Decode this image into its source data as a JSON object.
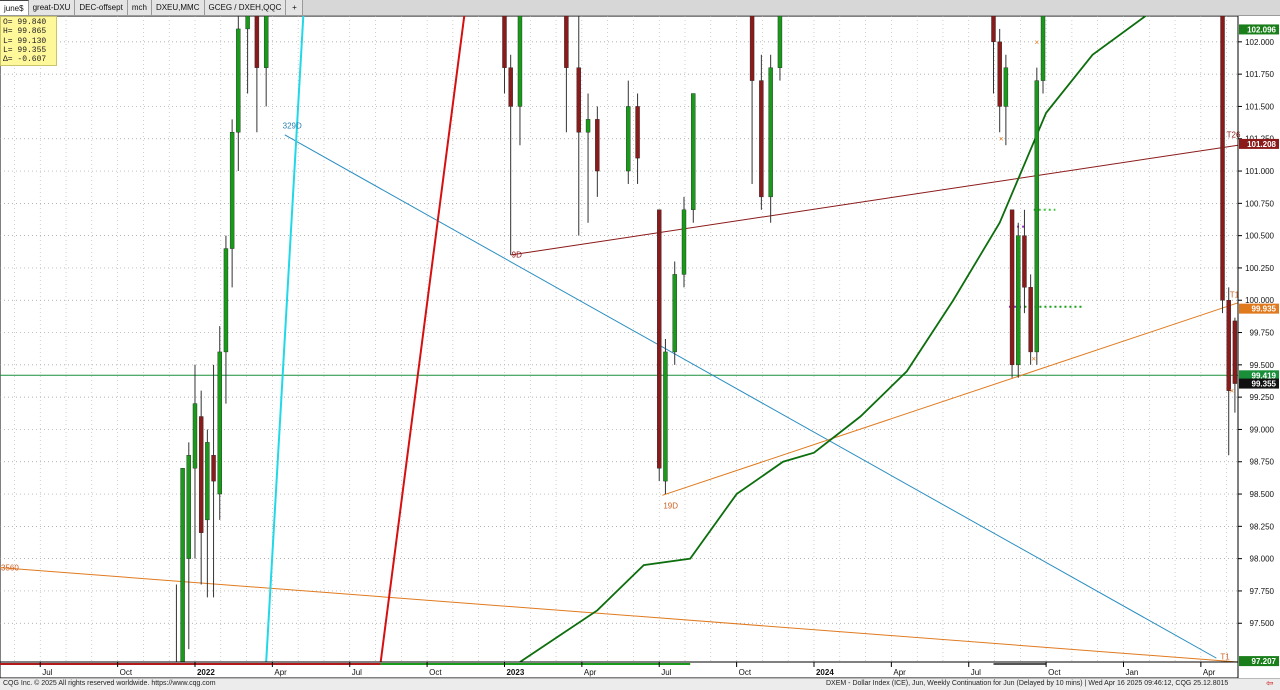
{
  "tabs": [
    {
      "label": "june$",
      "active": true
    },
    {
      "label": "great-DXU",
      "active": false
    },
    {
      "label": "DEC-offsept",
      "active": false
    },
    {
      "label": "mch",
      "active": false
    },
    {
      "label": "DXEU,MMC",
      "active": false
    },
    {
      "label": "GCEG / DXEH,QQC",
      "active": false
    },
    {
      "label": "+",
      "active": false
    }
  ],
  "ohlc": {
    "open": "O= 99.840",
    "high": "H= 99.865",
    "low": "L= 99.130",
    "last": "L= 99.355",
    "delta": "Δ= -0.607"
  },
  "footer": {
    "left": "CQG Inc. © 2025 All rights reserved worldwide. https://www.cqg.com",
    "right": "DXEM - Dollar Index (ICE), Jun, Weekly Continuation for Jun (Delayed by 10 mins) | Wed Apr 16 2025 09:46:12, CQG 25.12.8015",
    "arrow": "⇦"
  },
  "chart_data": {
    "type": "candlestick",
    "grid": true,
    "y_axis": {
      "side": "right",
      "min": 97.2,
      "max": 102.2,
      "ticks": [
        "97.500",
        "97.750",
        "98.000",
        "98.250",
        "98.500",
        "98.750",
        "99.000",
        "99.250",
        "99.500",
        "99.750",
        "100.000",
        "100.250",
        "100.500",
        "100.750",
        "101.000",
        "101.250",
        "101.500",
        "101.750",
        "102.000"
      ]
    },
    "x_axis": {
      "labels": [
        {
          "text": "Jul",
          "x": 2021.5
        },
        {
          "text": "Oct",
          "x": 2021.75
        },
        {
          "text": "2022",
          "x": 2022.0
        },
        {
          "text": "Apr",
          "x": 2022.25
        },
        {
          "text": "Jul",
          "x": 2022.5
        },
        {
          "text": "Oct",
          "x": 2022.75
        },
        {
          "text": "2023",
          "x": 2023.0
        },
        {
          "text": "Apr",
          "x": 2023.25
        },
        {
          "text": "Jul",
          "x": 2023.5
        },
        {
          "text": "Oct",
          "x": 2023.75
        },
        {
          "text": "2024",
          "x": 2024.0
        },
        {
          "text": "Apr",
          "x": 2024.25
        },
        {
          "text": "Jul",
          "x": 2024.5
        },
        {
          "text": "Oct",
          "x": 2024.75
        },
        {
          "text": "Jan",
          "x": 2025.0
        },
        {
          "text": "Apr",
          "x": 2025.25
        }
      ],
      "min": 2021.37,
      "max": 2025.37
    },
    "price_labels": [
      {
        "text": "102.096",
        "value": 102.096,
        "bg": "#1a7f1a",
        "fg": "#ffffff"
      },
      {
        "text": "101.208",
        "value": 101.21,
        "bg": "#8b1a1a",
        "fg": "#ffffff"
      },
      {
        "text": "99.935",
        "value": 99.935,
        "bg": "#e07a1f",
        "fg": "#ffffff"
      },
      {
        "text": "99.419",
        "value": 99.419,
        "bg": "#1a8f3a",
        "fg": "#ffffff"
      },
      {
        "text": "99.355",
        "value": 99.355,
        "bg": "#111111",
        "fg": "#ffffff"
      },
      {
        "text": "97.207",
        "value": 97.207,
        "bg": "#1a7f1a",
        "fg": "#ffffff"
      }
    ],
    "hline": {
      "value": 99.419,
      "color": "#1a8f3a"
    },
    "annotations": [
      {
        "text": "329D",
        "x": 2022.28,
        "y": 101.33,
        "color": "#2a7fb0"
      },
      {
        "text": "3560",
        "x": 2021.37,
        "y": 97.91,
        "color": "#d06020"
      },
      {
        "text": "9D",
        "x": 2023.02,
        "y": 100.33,
        "color": "#8b1a1a"
      },
      {
        "text": "19D",
        "x": 2023.51,
        "y": 98.39,
        "color": "#d06020"
      },
      {
        "text": "T26",
        "x": 2025.33,
        "y": 101.26,
        "color": "#8b1a1a"
      },
      {
        "text": "T1",
        "x": 2025.34,
        "y": 100.02,
        "color": "#d06020"
      },
      {
        "text": "T1",
        "x": 2025.31,
        "y": 97.22,
        "color": "#d06020"
      }
    ],
    "trendlines": [
      {
        "name": "",
        "color": "#2a8ec0",
        "points": [
          [
            2022.29,
            101.28
          ],
          [
            2025.3,
            97.23
          ]
        ]
      },
      {
        "name": "",
        "color": "#e07a1f",
        "points": [
          [
            2021.37,
            97.93
          ],
          [
            2025.37,
            97.2
          ]
        ]
      },
      {
        "name": "",
        "color": "#8b1a1a",
        "points": [
          [
            2023.02,
            100.35
          ],
          [
            2025.37,
            101.2
          ]
        ]
      },
      {
        "name": "",
        "color": "#e07a1f",
        "points": [
          [
            2023.51,
            98.49
          ],
          [
            2025.37,
            99.98
          ]
        ]
      },
      {
        "name": "",
        "color": "#d61010",
        "points": [
          [
            2022.6,
            97.2
          ],
          [
            2022.87,
            102.2
          ]
        ]
      },
      {
        "name": "",
        "color": "#22d8e8",
        "points": [
          [
            2022.23,
            97.2
          ],
          [
            2022.35,
            102.2
          ]
        ]
      }
    ],
    "moving_average": {
      "color": "#0d6e0d",
      "points": [
        [
          2023.05,
          97.2
        ],
        [
          2023.3,
          97.6
        ],
        [
          2023.45,
          97.95
        ],
        [
          2023.6,
          98.0
        ],
        [
          2023.75,
          98.5
        ],
        [
          2023.9,
          98.75
        ],
        [
          2024.0,
          98.82
        ],
        [
          2024.15,
          99.1
        ],
        [
          2024.3,
          99.45
        ],
        [
          2024.45,
          100.0
        ],
        [
          2024.6,
          100.6
        ],
        [
          2024.75,
          101.45
        ],
        [
          2024.9,
          101.9
        ],
        [
          2025.1,
          102.25
        ],
        [
          2025.3,
          102.3
        ]
      ]
    },
    "markers": [
      {
        "x": 2024.605,
        "y": 101.25,
        "type": "x",
        "color": "#e07a1f"
      },
      {
        "x": 2024.72,
        "y": 102.0,
        "type": "x",
        "color": "#e07a1f"
      },
      {
        "x": 2024.71,
        "y": 99.55,
        "type": "x",
        "color": "#e07a1f"
      },
      {
        "x": 2025.35,
        "y": 99.3,
        "type": "x",
        "color": "#e07a1f"
      }
    ],
    "dotted_levels": [
      {
        "x0": 2024.68,
        "x1": 2024.87,
        "y": 99.95,
        "color": "#18a018"
      },
      {
        "x0": 2024.63,
        "x1": 2024.68,
        "y": 99.95,
        "color": "#9a30c8"
      },
      {
        "x0": 2024.64,
        "x1": 2024.68,
        "y": 100.57,
        "color": "#9a30c8"
      },
      {
        "x0": 2024.71,
        "x1": 2024.78,
        "y": 100.7,
        "color": "#3cc03c"
      }
    ],
    "candles": [
      {
        "x": 2021.94,
        "o": 97.2,
        "h": 97.8,
        "l": 97.2,
        "c": 97.2,
        "dir": "down"
      },
      {
        "x": 2021.96,
        "o": 97.2,
        "h": 98.7,
        "l": 97.2,
        "c": 98.7,
        "dir": "up"
      },
      {
        "x": 2021.98,
        "o": 98.0,
        "h": 98.9,
        "l": 97.3,
        "c": 98.8,
        "dir": "up"
      },
      {
        "x": 2022.0,
        "o": 98.7,
        "h": 99.5,
        "l": 98.0,
        "c": 99.2,
        "dir": "up"
      },
      {
        "x": 2022.02,
        "o": 99.1,
        "h": 99.3,
        "l": 97.8,
        "c": 98.2,
        "dir": "down"
      },
      {
        "x": 2022.04,
        "o": 98.3,
        "h": 99.0,
        "l": 97.7,
        "c": 98.9,
        "dir": "up"
      },
      {
        "x": 2022.06,
        "o": 98.8,
        "h": 99.5,
        "l": 97.7,
        "c": 98.6,
        "dir": "down"
      },
      {
        "x": 2022.08,
        "o": 98.5,
        "h": 99.8,
        "l": 98.3,
        "c": 99.6,
        "dir": "up"
      },
      {
        "x": 2022.1,
        "o": 99.6,
        "h": 100.5,
        "l": 99.2,
        "c": 100.4,
        "dir": "up"
      },
      {
        "x": 2022.12,
        "o": 100.4,
        "h": 101.4,
        "l": 100.1,
        "c": 101.3,
        "dir": "up"
      },
      {
        "x": 2022.14,
        "o": 101.3,
        "h": 102.2,
        "l": 101.0,
        "c": 102.1,
        "dir": "up"
      },
      {
        "x": 2022.17,
        "o": 102.1,
        "h": 102.3,
        "l": 101.6,
        "c": 102.2,
        "dir": "up"
      },
      {
        "x": 2022.2,
        "o": 102.2,
        "h": 102.3,
        "l": 101.3,
        "c": 101.8,
        "dir": "down"
      },
      {
        "x": 2022.23,
        "o": 101.8,
        "h": 102.3,
        "l": 101.5,
        "c": 102.2,
        "dir": "up"
      },
      {
        "x": 2023.0,
        "o": 102.2,
        "h": 102.3,
        "l": 101.6,
        "c": 101.8,
        "dir": "down"
      },
      {
        "x": 2023.02,
        "o": 101.8,
        "h": 101.9,
        "l": 100.35,
        "c": 101.5,
        "dir": "down"
      },
      {
        "x": 2023.05,
        "o": 101.5,
        "h": 102.3,
        "l": 101.2,
        "c": 102.2,
        "dir": "up"
      },
      {
        "x": 2023.2,
        "o": 102.2,
        "h": 102.3,
        "l": 101.3,
        "c": 101.8,
        "dir": "down"
      },
      {
        "x": 2023.24,
        "o": 101.8,
        "h": 102.2,
        "l": 100.5,
        "c": 101.3,
        "dir": "down"
      },
      {
        "x": 2023.27,
        "o": 101.3,
        "h": 101.6,
        "l": 100.6,
        "c": 101.4,
        "dir": "up"
      },
      {
        "x": 2023.3,
        "o": 101.4,
        "h": 101.5,
        "l": 100.8,
        "c": 101.0,
        "dir": "down"
      },
      {
        "x": 2023.4,
        "o": 101.0,
        "h": 101.7,
        "l": 100.9,
        "c": 101.5,
        "dir": "up"
      },
      {
        "x": 2023.43,
        "o": 101.5,
        "h": 101.6,
        "l": 100.9,
        "c": 101.1,
        "dir": "down"
      },
      {
        "x": 2023.5,
        "o": 100.7,
        "h": 100.7,
        "l": 98.6,
        "c": 98.7,
        "dir": "down"
      },
      {
        "x": 2023.52,
        "o": 98.6,
        "h": 99.7,
        "l": 98.5,
        "c": 99.6,
        "dir": "up"
      },
      {
        "x": 2023.55,
        "o": 99.6,
        "h": 100.3,
        "l": 99.5,
        "c": 100.2,
        "dir": "up"
      },
      {
        "x": 2023.58,
        "o": 100.2,
        "h": 100.8,
        "l": 100.1,
        "c": 100.7,
        "dir": "up"
      },
      {
        "x": 2023.61,
        "o": 100.7,
        "h": 101.6,
        "l": 100.6,
        "c": 101.6,
        "dir": "up"
      },
      {
        "x": 2023.8,
        "o": 102.2,
        "h": 102.3,
        "l": 100.9,
        "c": 101.7,
        "dir": "down"
      },
      {
        "x": 2023.83,
        "o": 101.7,
        "h": 101.9,
        "l": 100.7,
        "c": 100.8,
        "dir": "down"
      },
      {
        "x": 2023.86,
        "o": 100.8,
        "h": 101.9,
        "l": 100.6,
        "c": 101.8,
        "dir": "up"
      },
      {
        "x": 2023.89,
        "o": 101.8,
        "h": 102.3,
        "l": 101.7,
        "c": 102.2,
        "dir": "up"
      },
      {
        "x": 2024.58,
        "o": 102.2,
        "h": 102.3,
        "l": 101.6,
        "c": 102.0,
        "dir": "down"
      },
      {
        "x": 2024.6,
        "o": 102.0,
        "h": 102.1,
        "l": 101.3,
        "c": 101.5,
        "dir": "down"
      },
      {
        "x": 2024.62,
        "o": 101.5,
        "h": 101.9,
        "l": 101.2,
        "c": 101.8,
        "dir": "up"
      },
      {
        "x": 2024.64,
        "o": 100.7,
        "h": 100.7,
        "l": 99.4,
        "c": 99.5,
        "dir": "down"
      },
      {
        "x": 2024.66,
        "o": 99.5,
        "h": 100.6,
        "l": 99.4,
        "c": 100.5,
        "dir": "up"
      },
      {
        "x": 2024.68,
        "o": 100.5,
        "h": 100.7,
        "l": 99.9,
        "c": 100.1,
        "dir": "down"
      },
      {
        "x": 2024.7,
        "o": 100.1,
        "h": 100.2,
        "l": 99.5,
        "c": 99.6,
        "dir": "down"
      },
      {
        "x": 2024.72,
        "o": 99.6,
        "h": 101.8,
        "l": 99.5,
        "c": 101.7,
        "dir": "up"
      },
      {
        "x": 2024.74,
        "o": 101.7,
        "h": 102.3,
        "l": 101.6,
        "c": 102.2,
        "dir": "up"
      },
      {
        "x": 2025.32,
        "o": 102.2,
        "h": 102.3,
        "l": 99.9,
        "c": 100.0,
        "dir": "down"
      },
      {
        "x": 2025.34,
        "o": 100.0,
        "h": 100.1,
        "l": 98.8,
        "c": 99.3,
        "dir": "down"
      },
      {
        "x": 2025.36,
        "o": 99.84,
        "h": 99.865,
        "l": 99.13,
        "c": 99.355,
        "dir": "down"
      }
    ]
  }
}
